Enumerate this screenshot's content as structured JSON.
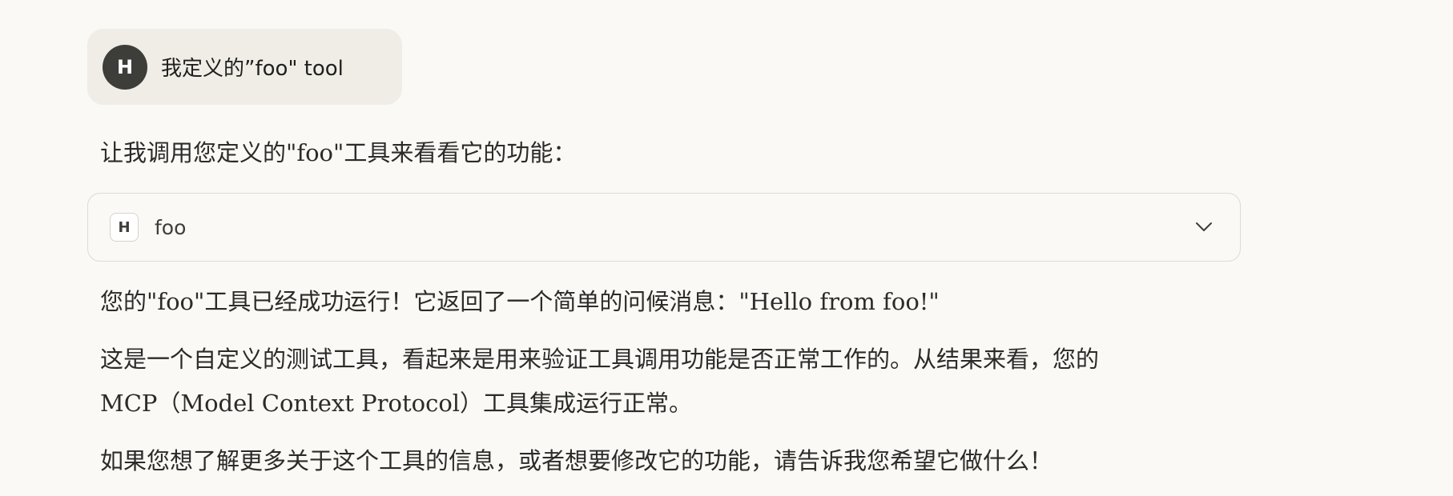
{
  "user_message": {
    "avatar_initial": "H",
    "text": "我定义的”foo\" tool"
  },
  "assistant": {
    "intro": "让我调用您定义的\"foo\"工具来看看它的功能：",
    "tool_call": {
      "icon_letter": "H",
      "name": "foo",
      "chevron_icon": "chevron-down-icon"
    },
    "result_text": "您的\"foo\"工具已经成功运行！它返回了一个简单的问候消息：\"Hello from foo!\"",
    "explain_line1": "这是一个自定义的测试工具，看起来是用来验证工具调用功能是否正常工作的。从结果来看，您的",
    "explain_line2": "MCP（Model Context Protocol）工具集成运行正常。",
    "offer": "如果您想了解更多关于这个工具的信息，或者想要修改它的功能，请告诉我您希望它做什么！"
  },
  "colors": {
    "background": "#faf9f6",
    "user_bubble": "#f0ede7",
    "avatar": "#3d3d3a",
    "text": "#2b2b29",
    "card_border": "#dedbd3"
  }
}
